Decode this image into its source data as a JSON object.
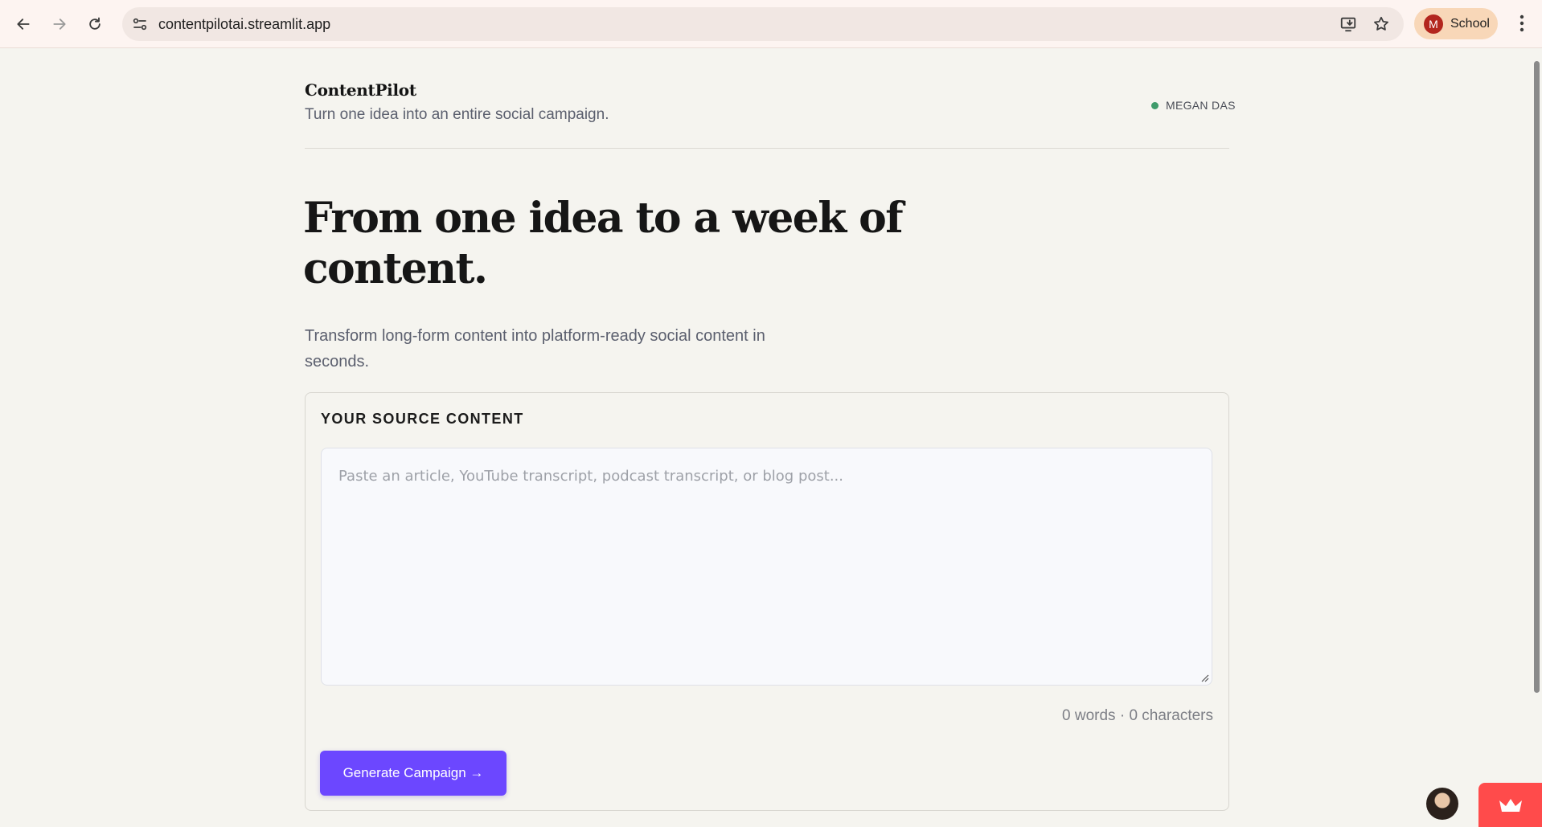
{
  "browser": {
    "url": "contentpilotai.streamlit.app",
    "profile_initial": "M",
    "profile_name": "School",
    "accent": "#b3261e"
  },
  "header": {
    "brand": "ContentPilot",
    "tagline": "Turn one idea into an entire social campaign.",
    "user": "MEGAN DAS",
    "status_color": "#3f9b6b"
  },
  "hero": {
    "title": "From one idea to a week of content.",
    "subtitle": "Transform long-form content into platform-ready social content in seconds."
  },
  "source": {
    "label": "YOUR SOURCE CONTENT",
    "placeholder": "Paste an article, YouTube transcript, podcast transcript, or blog post...",
    "counter": "0 words · 0 characters",
    "button_label": "Generate Campaign →",
    "button_color": "#6c47ff"
  }
}
